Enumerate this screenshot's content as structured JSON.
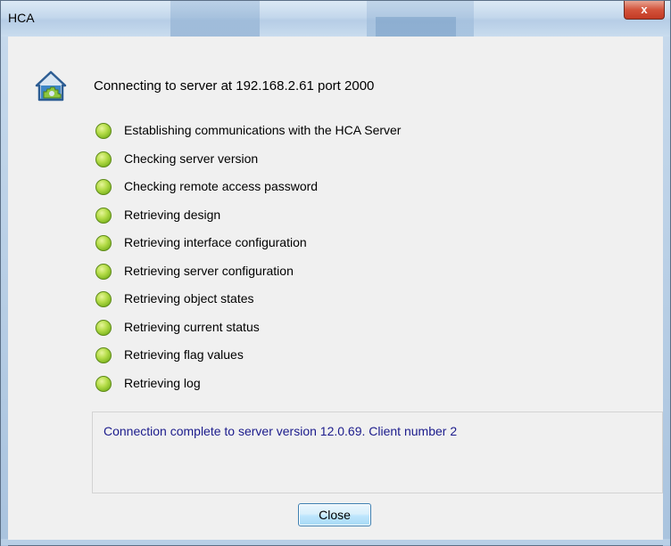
{
  "window": {
    "title": "HCA",
    "close_glyph": "x"
  },
  "header": {
    "icon": "hca-house-gear-icon",
    "connecting_text": "Connecting to server at 192.168.2.61 port 2000"
  },
  "steps": [
    {
      "label": "Establishing communications with the HCA Server",
      "status": "complete",
      "color": "#9ccc2e"
    },
    {
      "label": "Checking server version",
      "status": "complete",
      "color": "#9ccc2e"
    },
    {
      "label": "Checking remote access password",
      "status": "complete",
      "color": "#9ccc2e"
    },
    {
      "label": "Retrieving design",
      "status": "complete",
      "color": "#9ccc2e"
    },
    {
      "label": "Retrieving interface configuration",
      "status": "complete",
      "color": "#9ccc2e"
    },
    {
      "label": "Retrieving server configuration",
      "status": "complete",
      "color": "#9ccc2e"
    },
    {
      "label": "Retrieving object states",
      "status": "complete",
      "color": "#9ccc2e"
    },
    {
      "label": "Retrieving current status",
      "status": "complete",
      "color": "#9ccc2e"
    },
    {
      "label": "Retrieving flag values",
      "status": "complete",
      "color": "#9ccc2e"
    },
    {
      "label": "Retrieving log",
      "status": "complete",
      "color": "#9ccc2e"
    }
  ],
  "status": {
    "message": "Connection complete to server version 12.0.69.  Client number 2",
    "color": "#1c1c8c"
  },
  "buttons": {
    "close_label": "Close"
  }
}
